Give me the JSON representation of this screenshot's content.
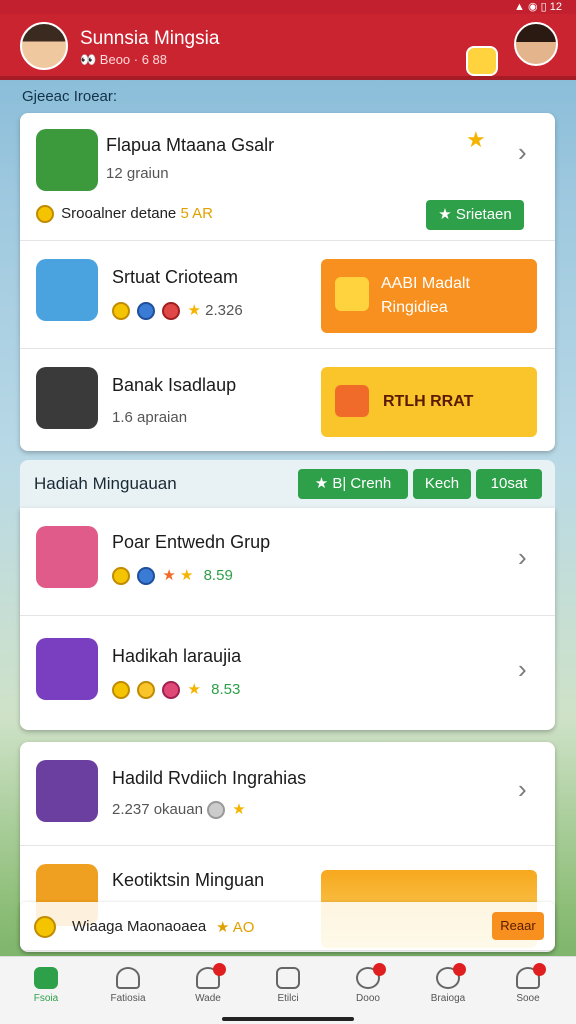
{
  "status": {
    "icons": "▲ ◉ ▯",
    "time": "12"
  },
  "header": {
    "title": "Sunnsia Mingsia",
    "subtitle": "👀 Beoo · 6 88"
  },
  "section1": {
    "label": "Gjeeac Iroear:"
  },
  "row1": {
    "title": "Flapua Mtaana Gsalr",
    "sub": "12 graiun",
    "promo": "Srooalner detane",
    "promo_value": "5 AR",
    "button": "Srietaen"
  },
  "row2": {
    "title": "Srtuat Crioteam",
    "meta": "2.326",
    "button_line1": "AABI Madalt",
    "button_line2": "Ringidiea"
  },
  "row3": {
    "title": "Banak Isadlaup",
    "sub": "1.6 apraian",
    "button": "RTLH RRAT"
  },
  "section2": {
    "title": "Hadiah Minguauan",
    "chips": [
      "★ B| Crenh",
      "Kech",
      "10sat"
    ]
  },
  "row4": {
    "title": "Poar Entwedn Grup",
    "value": "8.59"
  },
  "row5": {
    "title": "Hadikah laraujia",
    "value": "8.53"
  },
  "row6": {
    "title": "Hadild Rvdiich Ingrahias",
    "sub": "2.237 okauan"
  },
  "row7": {
    "title": "Keotiktsin Minguan"
  },
  "footer_notice": {
    "text": "Wiaaga Maonaoaea",
    "value": "★ AO",
    "button": "Reaar"
  },
  "tabs": [
    {
      "label": "Fsoia"
    },
    {
      "label": "Fatiosia"
    },
    {
      "label": "Wade"
    },
    {
      "label": "Etilci"
    },
    {
      "label": "Dooo"
    },
    {
      "label": "Braioga"
    },
    {
      "label": "Sooe"
    }
  ],
  "colors": {
    "brand": "#cb2431",
    "green": "#2ea04a",
    "orange": "#f7901e",
    "yellow": "#f9c52b"
  }
}
